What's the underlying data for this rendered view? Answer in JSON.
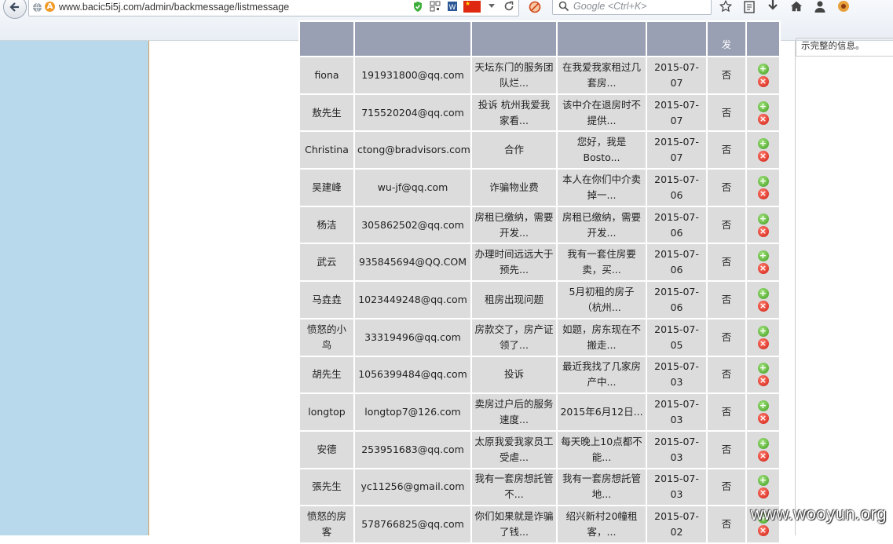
{
  "browser": {
    "url": "www.bacic5i5j.com/admin/backmessage/listmessage",
    "search_placeholder": "Google <Ctrl+K>",
    "warn_badge": "A"
  },
  "right_panel": {
    "note": "示完整的信息。"
  },
  "table": {
    "header_partial": "发",
    "no_label": "否",
    "rows": [
      {
        "name": "fiona",
        "email": "191931800@qq.com",
        "subject": "天坛东门的服务团队烂...",
        "content": "在我爱我家租过几套房...",
        "date": "2015-07-07",
        "flag": "否"
      },
      {
        "name": "敖先生",
        "email": "715520204@qq.com",
        "subject": "投诉 杭州我爱我家看...",
        "content": "该中介在退房时不提供...",
        "date": "2015-07-07",
        "flag": "否"
      },
      {
        "name": "Christina",
        "email": "ctong@bradvisors.com",
        "subject": "合作",
        "content": "您好，我是Bosto...",
        "date": "2015-07-07",
        "flag": "否"
      },
      {
        "name": "吴建峰",
        "email": "wu-jf@qq.com",
        "subject": "诈骗物业费",
        "content": "本人在你们中介卖掉一...",
        "date": "2015-07-06",
        "flag": "否"
      },
      {
        "name": "杨洁",
        "email": "305862502@qq.com",
        "subject": "房租已缴纳，需要开发...",
        "content": "房租已缴纳，需要开发...",
        "date": "2015-07-06",
        "flag": "否"
      },
      {
        "name": "武云",
        "email": "935845694@QQ.COM",
        "subject": "办理时间远远大于预先...",
        "content": "我有一套住房要卖，买...",
        "date": "2015-07-06",
        "flag": "否"
      },
      {
        "name": "马垚垚",
        "email": "1023449248@qq.com",
        "subject": "租房出现问题",
        "content": "5月初租的房子（杭州...",
        "date": "2015-07-06",
        "flag": "否"
      },
      {
        "name": "愤怒的小鸟",
        "email": "33319496@qq.com",
        "subject": "房款交了，房产证领了...",
        "content": "如题，房东现在不搬走...",
        "date": "2015-07-05",
        "flag": "否"
      },
      {
        "name": "胡先生",
        "email": "1056399484@qq.com",
        "subject": "投诉",
        "content": "最近我找了几家房产中...",
        "date": "2015-07-03",
        "flag": "否"
      },
      {
        "name": "longtop",
        "email": "longtop7@126.com",
        "subject": "卖房过户后的服务速度...",
        "content": "2015年6月12日...",
        "date": "2015-07-03",
        "flag": "否"
      },
      {
        "name": "安德",
        "email": "253951683@qq.com",
        "subject": "太原我爱我家员工受虐...",
        "content": "每天晚上10点都不能...",
        "date": "2015-07-03",
        "flag": "否"
      },
      {
        "name": "張先生",
        "email": "yc11256@gmail.com",
        "subject": "我有一套房想託管不...",
        "content": "我有一套房想託管地...",
        "date": "2015-07-03",
        "flag": "否"
      },
      {
        "name": "愤怒的房客",
        "email": "578766825@qq.com",
        "subject": "你们如果就是诈骗了钱...",
        "content": "绍兴新村20幢租客，...",
        "date": "2015-07-02",
        "flag": "否"
      }
    ]
  },
  "watermark": "www.wooyun.org",
  "colors": {
    "sidebar": "#b8d8ec",
    "header": "#9aa0b3",
    "cell": "#dcdcdc",
    "add": "#3f9d1e",
    "delete": "#d01b10"
  }
}
